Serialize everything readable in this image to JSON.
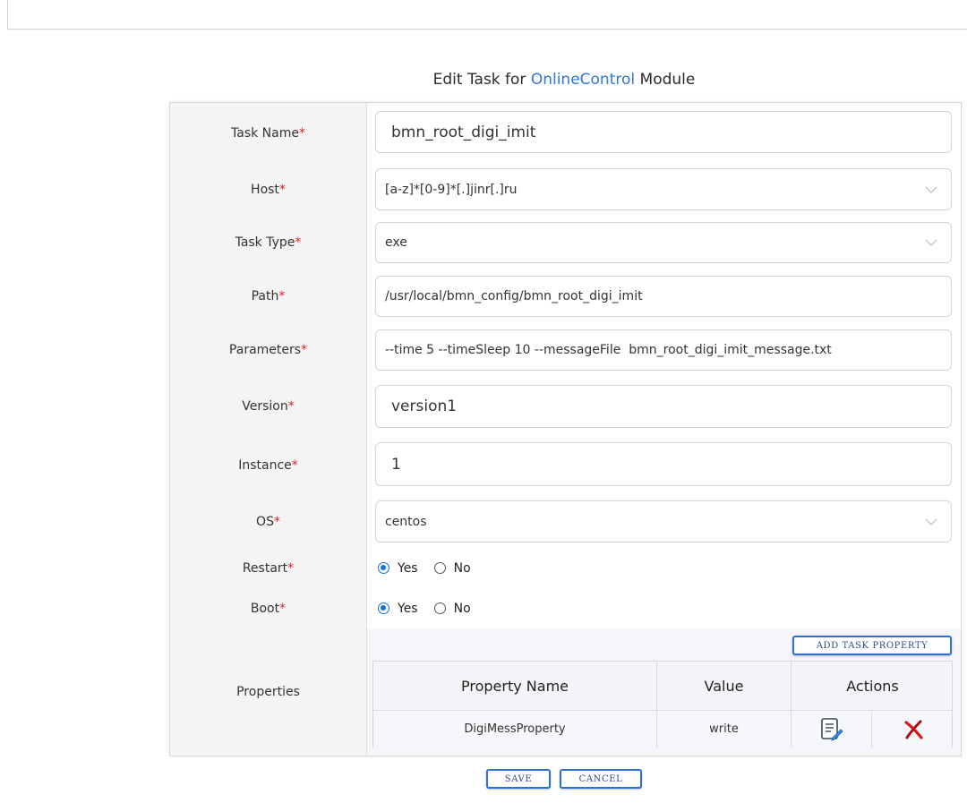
{
  "header": {
    "title_prefix": "Edit Task for ",
    "module_name": "OnlineControl",
    "title_suffix": " Module"
  },
  "required_mark": "*",
  "fields": {
    "task_name": {
      "label": "Task Name",
      "value": "bmn_root_digi_imit"
    },
    "host": {
      "label": "Host",
      "value": "[a-z]*[0-9]*[.]jinr[.]ru"
    },
    "task_type": {
      "label": "Task Type",
      "value": "exe"
    },
    "path": {
      "label": "Path",
      "value": "/usr/local/bmn_config/bmn_root_digi_imit"
    },
    "parameters": {
      "label": "Parameters",
      "value": "--time 5 --timeSleep 10 --messageFile  bmn_root_digi_imit_message.txt"
    },
    "version": {
      "label": "Version",
      "value": "version1"
    },
    "instance": {
      "label": "Instance",
      "value": "1"
    },
    "os": {
      "label": "OS",
      "value": "centos"
    },
    "restart": {
      "label": "Restart",
      "yes_label": "Yes",
      "no_label": "No",
      "selected": "Yes"
    },
    "boot": {
      "label": "Boot",
      "yes_label": "Yes",
      "no_label": "No",
      "selected": "Yes"
    }
  },
  "properties": {
    "label": "Properties",
    "add_button": "ADD TASK PROPERTY",
    "columns": {
      "name": "Property Name",
      "value": "Value",
      "actions": "Actions"
    },
    "rows": [
      {
        "name": "DigiMessProperty",
        "value": "write",
        "edit_icon": "edit-document-icon",
        "delete_icon": "delete-x-icon"
      }
    ]
  },
  "buttons": {
    "save": "SAVE",
    "cancel": "CANCEL"
  },
  "colors": {
    "accent": "#2f76d6",
    "required": "#d8232a",
    "radio": "#1a6fe0",
    "delete": "#d61a1a"
  }
}
